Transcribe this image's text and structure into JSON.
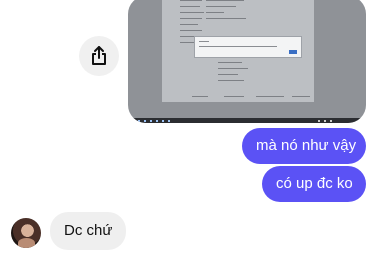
{
  "icons": {
    "share": "share-icon",
    "avatar": "avatar-image"
  },
  "messages": [
    {
      "direction": "outgoing",
      "text": "mà nó như vậy"
    },
    {
      "direction": "outgoing",
      "text": "có up đc ko"
    },
    {
      "direction": "incoming",
      "text": "Dc chứ"
    }
  ],
  "colors": {
    "outgoing_bubble": "#5b52f5",
    "incoming_bubble": "#efefef",
    "share_button": "#f0f0f0"
  }
}
